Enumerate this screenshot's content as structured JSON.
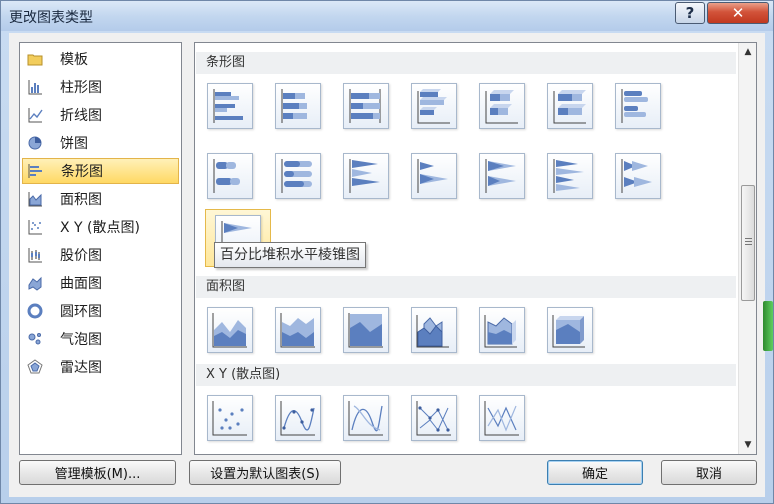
{
  "window": {
    "title": "更改图表类型",
    "help_label": "?",
    "close_label": "✕"
  },
  "sidebar": {
    "items": [
      {
        "label": "模板",
        "icon": "folder-icon"
      },
      {
        "label": "柱形图",
        "icon": "column-chart-icon"
      },
      {
        "label": "折线图",
        "icon": "line-chart-icon"
      },
      {
        "label": "饼图",
        "icon": "pie-chart-icon"
      },
      {
        "label": "条形图",
        "icon": "bar-chart-icon",
        "selected": true
      },
      {
        "label": "面积图",
        "icon": "area-chart-icon"
      },
      {
        "label": "X Y (散点图)",
        "icon": "scatter-chart-icon"
      },
      {
        "label": "股价图",
        "icon": "stock-chart-icon"
      },
      {
        "label": "曲面图",
        "icon": "surface-chart-icon"
      },
      {
        "label": "圆环图",
        "icon": "doughnut-chart-icon"
      },
      {
        "label": "气泡图",
        "icon": "bubble-chart-icon"
      },
      {
        "label": "雷达图",
        "icon": "radar-chart-icon"
      }
    ]
  },
  "gallery": {
    "sections": [
      {
        "label": "条形图"
      },
      {
        "label": "面积图"
      },
      {
        "label": "X Y (散点图)"
      }
    ],
    "tooltip": "百分比堆积水平棱锥图"
  },
  "footer": {
    "manage_templates": "管理模板(M)...",
    "set_default": "设置为默认图表(S)",
    "ok": "确定",
    "cancel": "取消"
  },
  "colors": {
    "accent": "#5b7fbf",
    "selection": "#ffd964"
  }
}
